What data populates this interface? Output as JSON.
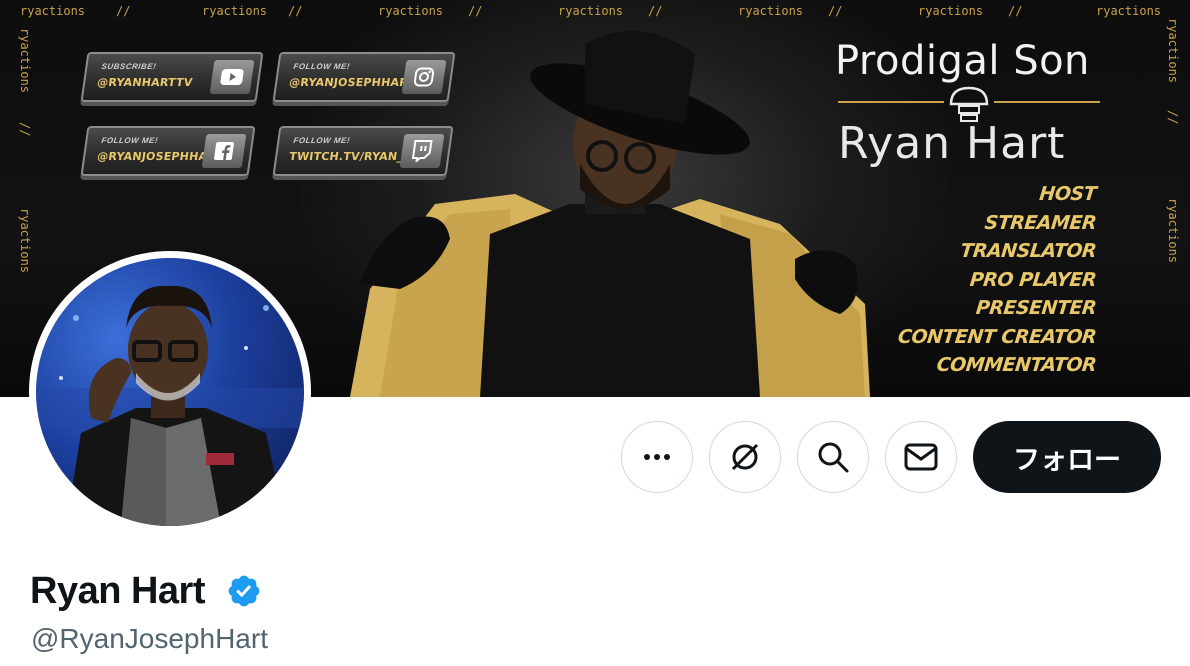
{
  "banner": {
    "watermark": "ryactions",
    "separator": "//",
    "socials": [
      {
        "caption": "SUBSCRIBE!",
        "handle": "@RYANHARTTV",
        "icon": "youtube-icon"
      },
      {
        "caption": "FOLLOW ME!",
        "handle": "@RYANJOSEPHHART",
        "icon": "instagram-icon"
      },
      {
        "caption": "FOLLOW ME!",
        "handle": "@RYANJOSEPHHART",
        "icon": "facebook-icon"
      },
      {
        "caption": "FOLLOW ME!",
        "handle": "TWITCH.TV/RYAN_HART",
        "icon": "twitch-icon"
      }
    ],
    "title_top": "Prodigal Son",
    "title_main": "Ryan Hart",
    "roles": [
      "HOST",
      "STREAMER",
      "TRANSLATOR",
      "PRO PLAYER",
      "PRESENTER",
      "CONTENT CREATOR",
      "COMMENTATOR"
    ],
    "accent_color": "#c9a24a"
  },
  "actions": {
    "more_icon": "more-dots-icon",
    "grok_icon": "grok-icon",
    "search_icon": "search-icon",
    "message_icon": "envelope-icon",
    "follow_label": "フォロー"
  },
  "profile": {
    "display_name": "Ryan Hart",
    "handle": "@RyanJosephHart",
    "verified_color": "#1d9bf0"
  }
}
